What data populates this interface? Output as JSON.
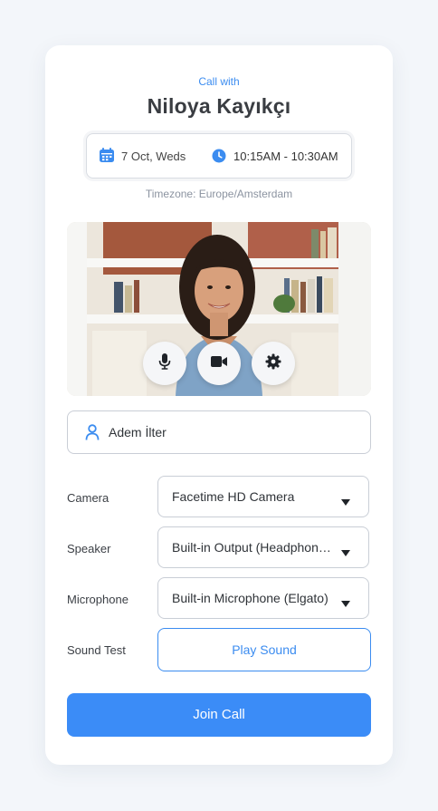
{
  "header": {
    "call_with": "Call with",
    "caller_name": "Niloya Kayıkçı",
    "date": "7 Oct, Weds",
    "time": "10:15AM - 10:30AM",
    "timezone": "Timezone: Europe/Amsterdam"
  },
  "video": {
    "controls": [
      {
        "name": "microphone",
        "icon": "microphone-icon"
      },
      {
        "name": "camera",
        "icon": "video-camera-icon"
      },
      {
        "name": "settings",
        "icon": "gear-icon"
      }
    ]
  },
  "participant": {
    "name": "Adem İlter"
  },
  "settings": {
    "camera_label": "Camera",
    "camera_value": "Facetime HD Camera",
    "speaker_label": "Speaker",
    "speaker_value": "Built-in Output (Headphones)",
    "microphone_label": "Microphone",
    "microphone_value": "Built-in Microphone (Elgato)",
    "sound_test_label": "Sound Test",
    "play_sound_label": "Play Sound"
  },
  "actions": {
    "join_label": "Join Call"
  },
  "colors": {
    "accent": "#3b8cf7",
    "background": "#f3f6fa",
    "card": "#ffffff"
  }
}
